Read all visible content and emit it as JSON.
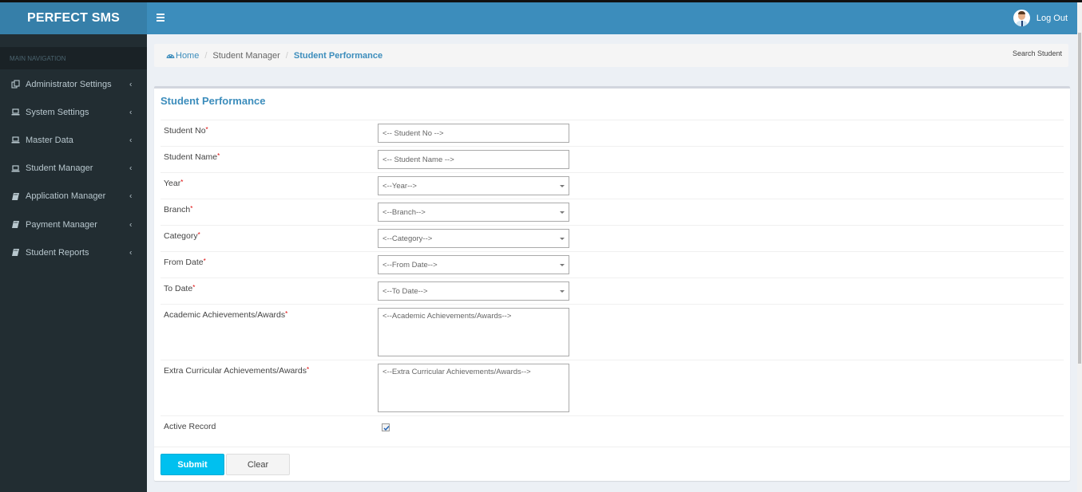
{
  "app": {
    "logo_text": "PERFECT SMS"
  },
  "header": {
    "logout_label": "Log Out",
    "menu_icon": "hamburger-icon",
    "avatar_icon": "user-avatar-icon"
  },
  "sidebar": {
    "section_header": "MAIN NAVIGATION",
    "items": [
      {
        "label": "Administrator Settings",
        "icon": "copy-icon"
      },
      {
        "label": "System Settings",
        "icon": "laptop-icon"
      },
      {
        "label": "Master Data",
        "icon": "laptop-icon"
      },
      {
        "label": "Student Manager",
        "icon": "laptop-icon"
      },
      {
        "label": "Application Manager",
        "icon": "book-icon"
      },
      {
        "label": "Payment Manager",
        "icon": "book-icon"
      },
      {
        "label": "Student Reports",
        "icon": "book-icon"
      }
    ]
  },
  "breadcrumb": {
    "home": "Home",
    "parent": "Student Manager",
    "current": "Student Performance",
    "right_link": "Search Student"
  },
  "form": {
    "title": "Student Performance",
    "required_mark": "*",
    "fields": [
      {
        "label": "Student No",
        "type": "text",
        "placeholder": "<-- Student No -->",
        "required": true
      },
      {
        "label": "Student Name",
        "type": "text",
        "placeholder": "<-- Student Name -->",
        "required": true
      },
      {
        "label": "Year",
        "type": "select",
        "selected": "<--Year-->",
        "required": true
      },
      {
        "label": "Branch",
        "type": "select",
        "selected": "<--Branch-->",
        "required": true
      },
      {
        "label": "Category",
        "type": "select",
        "selected": "<--Category-->",
        "required": true
      },
      {
        "label": "From Date",
        "type": "select",
        "selected": "<--From Date-->",
        "required": true
      },
      {
        "label": "To Date",
        "type": "select",
        "selected": "<--To Date-->",
        "required": true
      },
      {
        "label": "Academic Achievements/Awards",
        "type": "textarea",
        "placeholder": "<--Academic Achievements/Awards-->",
        "required": true
      },
      {
        "label": "Extra Curricular Achievements/Awards",
        "type": "textarea",
        "placeholder": "<--Extra Curricular Achievements/Awards-->",
        "required": true
      }
    ],
    "active_record": {
      "label": "Active Record",
      "checked": true
    },
    "submit_label": "Submit",
    "clear_label": "Clear"
  },
  "colors": {
    "header_bg": "#3c8dbc",
    "logo_bg": "#367fa9",
    "sidebar_bg": "#222d32",
    "accent": "#3c8dbc",
    "submit_bg": "#00c0ef",
    "required": "#dd0000"
  }
}
